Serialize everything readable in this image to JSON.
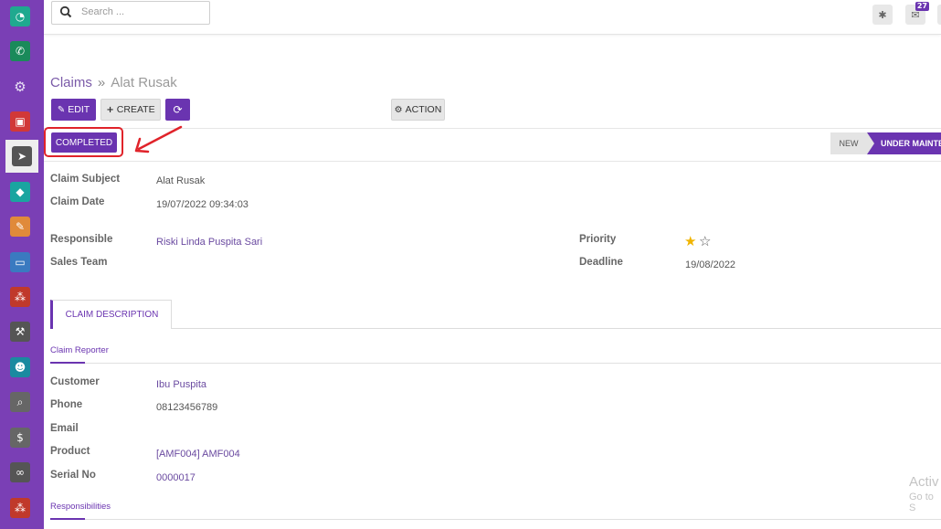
{
  "sidebar": {
    "items": [
      {
        "icon": "dashboard-icon",
        "color": "#1fa98f"
      },
      {
        "icon": "whatsapp-icon",
        "color": "#1a8a5a"
      },
      {
        "icon": "camera-settings-icon",
        "color": "#8a7cc0"
      },
      {
        "icon": "vehicle-icon",
        "color": "#d13838"
      },
      {
        "icon": "send-icon",
        "color": "#555555"
      },
      {
        "icon": "tag-icon",
        "color": "#1aa5a0"
      },
      {
        "icon": "edit-note-icon",
        "color": "#e08a3a"
      },
      {
        "icon": "card-icon",
        "color": "#3a7ac0"
      },
      {
        "icon": "boxes-icon",
        "color": "#c0392b"
      },
      {
        "icon": "hammer-icon",
        "color": "#555555"
      },
      {
        "icon": "team-icon",
        "color": "#1a8aa0"
      },
      {
        "icon": "search-doc-icon",
        "color": "#666666"
      },
      {
        "icon": "user-money-icon",
        "color": "#666666"
      },
      {
        "icon": "link-icon",
        "color": "#555555"
      },
      {
        "icon": "boxes-alt-icon",
        "color": "#c0392b"
      }
    ]
  },
  "topbar": {
    "search_placeholder": "Search ...",
    "bug_icon": "bug-icon",
    "messages_count": "27"
  },
  "breadcrumb": {
    "parent": "Claims",
    "separator": "»",
    "current": "Alat Rusak"
  },
  "toolbar": {
    "edit_label": "EDIT",
    "create_label": "CREATE",
    "action_label": "ACTION"
  },
  "statusbar": {
    "completed_label": "COMPLETED",
    "stages": [
      "NEW",
      "UNDER MAINTENANCE"
    ]
  },
  "form": {
    "claim_subject_label": "Claim Subject",
    "claim_subject": "Alat Rusak",
    "claim_date_label": "Claim Date",
    "claim_date": "19/07/2022 09:34:03",
    "responsible_label": "Responsible",
    "responsible": "Riski Linda Puspita Sari",
    "sales_team_label": "Sales Team",
    "sales_team": "",
    "priority_label": "Priority",
    "priority_stars": 1,
    "priority_max": 2,
    "deadline_label": "Deadline",
    "deadline": "19/08/2022"
  },
  "tabs": [
    {
      "label": "CLAIM DESCRIPTION",
      "active": true
    }
  ],
  "reporter": {
    "section_title": "Claim Reporter",
    "customer_label": "Customer",
    "customer": "Ibu Puspita",
    "phone_label": "Phone",
    "phone": "08123456789",
    "email_label": "Email",
    "email": "",
    "product_label": "Product",
    "product": "[AMF004] AMF004",
    "serial_label": "Serial No",
    "serial": "0000017"
  },
  "responsibilities": {
    "section_title": "Responsibilities"
  },
  "watermark": {
    "line1": "Activ",
    "line2": "Go to S"
  },
  "colors": {
    "brand": "#6a34b0",
    "sidebar": "#7a3fb5",
    "annotation": "#e0232a"
  }
}
